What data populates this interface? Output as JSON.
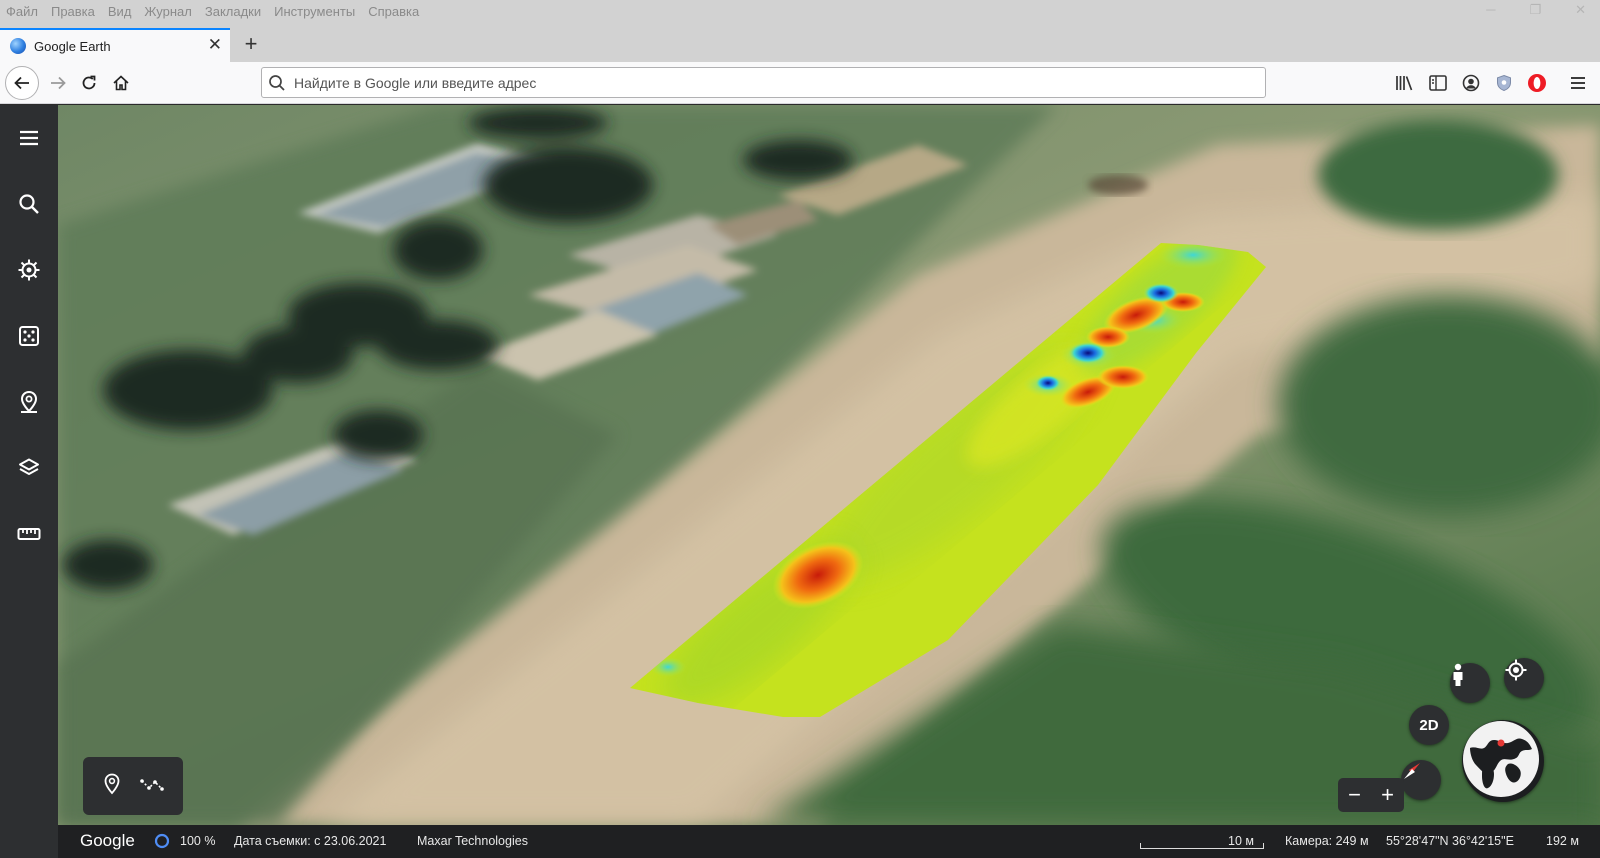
{
  "menu": [
    "Файл",
    "Правка",
    "Вид",
    "Журнал",
    "Закладки",
    "Инструменты",
    "Справка"
  ],
  "tab": {
    "title": "Google Earth",
    "close": "✕",
    "new_tab": "+"
  },
  "urlbar": {
    "placeholder": "Найдите в Google или введите адрес"
  },
  "status": {
    "google": "Google",
    "loading": "100 %",
    "imagery_date": "Дата съемки: с 23.06.2021",
    "provider": "Maxar Technologies",
    "scale": "10 м",
    "camera": "Камера: 249 м",
    "coords": "55°28'47\"N 36°42'15\"E",
    "elevation": "192 м"
  },
  "controls": {
    "view_2d": "2D",
    "zoom_out": "−",
    "zoom_in": "+"
  },
  "colors": {
    "sidebar": "#2d2f31",
    "accent_tab": "#0a84ff",
    "heatmap_low": "#1a1a8c",
    "heatmap_mid": "#c8e61e",
    "heatmap_high": "#e03a10"
  },
  "icons": {
    "sidebar": [
      "menu-icon",
      "search-icon",
      "voyager-icon",
      "feeling-lucky-icon",
      "projects-icon",
      "map-style-icon",
      "measure-icon"
    ],
    "toolbar": [
      "library-icon",
      "reader-icon",
      "account-icon",
      "shield-icon",
      "opera-icon",
      "hamburger-icon"
    ],
    "draw": [
      "placemark-icon",
      "path-icon"
    ]
  }
}
